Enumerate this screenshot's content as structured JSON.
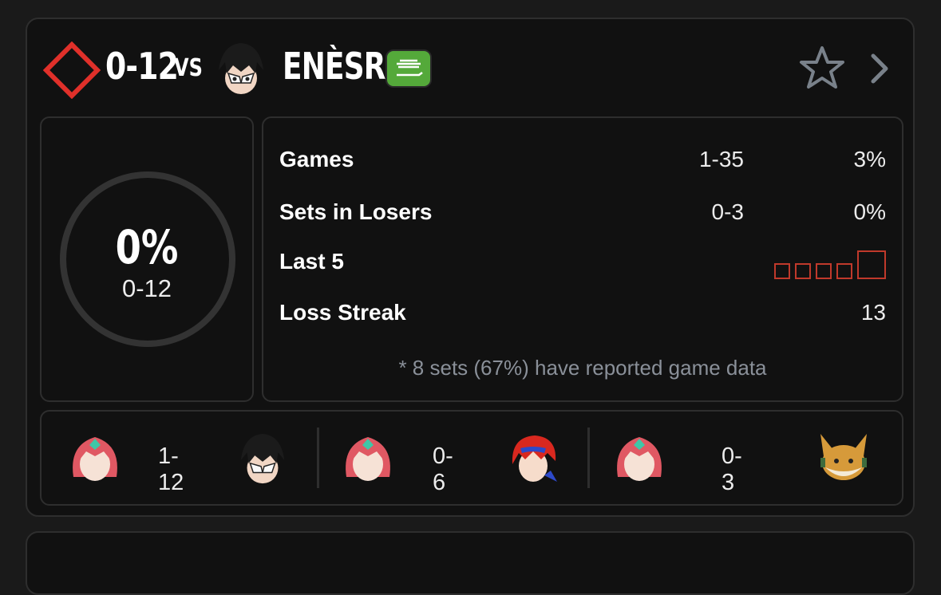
{
  "header": {
    "player_score": "0-12",
    "vs_label": "VS",
    "opponent_name": "ENÈSRA",
    "opponent_character_icon": "joker-icon",
    "flag_icon": "saudi-flag-icon",
    "favorite_icon": "star-outline-icon",
    "open_icon": "chevron-right-icon",
    "player_icon": "red-diamond-logo-icon"
  },
  "summary": {
    "win_percent": "0%",
    "record": "0-12",
    "win_fraction": 0
  },
  "stats": {
    "games": {
      "label": "Games",
      "record": "1-35",
      "percent": "3%"
    },
    "sets_in_losers": {
      "label": "Sets in Losers",
      "record": "0-3",
      "percent": "0%"
    },
    "last5": {
      "label": "Last 5",
      "results": [
        "L",
        "L",
        "L",
        "L",
        "L"
      ]
    },
    "loss_streak": {
      "label": "Loss Streak",
      "value": "13"
    },
    "note": "* 8 sets (67%) have reported game data"
  },
  "matchups": [
    {
      "player_character": "pyra-icon",
      "score": "1-12",
      "opponent_character": "joker-icon"
    },
    {
      "player_character": "pyra-icon",
      "score": "0-6",
      "opponent_character": "roy-icon"
    },
    {
      "player_character": "pyra-icon",
      "score": "0-3",
      "opponent_character": "fox-icon"
    }
  ],
  "colors": {
    "loss_red": "#c0392b",
    "panel_border": "#2e2e2e",
    "background": "#111111"
  }
}
